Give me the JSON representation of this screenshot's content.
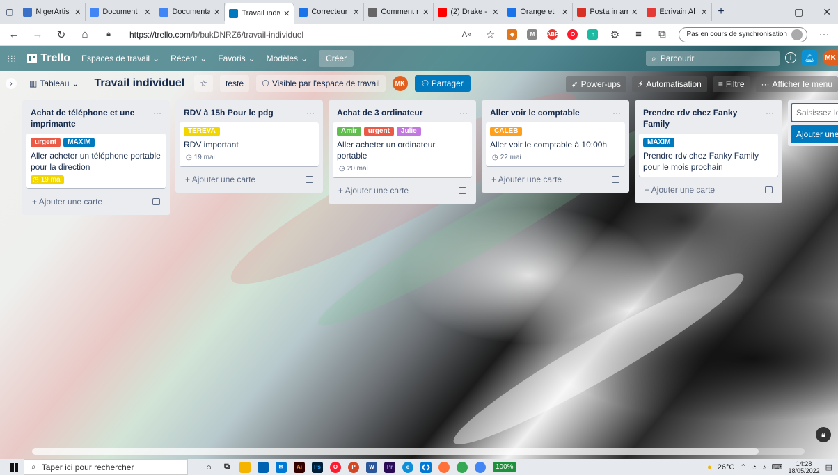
{
  "browser": {
    "tabs": [
      {
        "title": "NigerArtis",
        "color": "#3a70c5"
      },
      {
        "title": "Document",
        "color": "#4285f4"
      },
      {
        "title": "Documenta",
        "color": "#4285f4"
      },
      {
        "title": "Travail indiv",
        "color": "#0079bf",
        "active": true
      },
      {
        "title": "Correcteur",
        "color": "#1a73e8"
      },
      {
        "title": "Comment r",
        "color": "#666666"
      },
      {
        "title": "(2) Drake -",
        "color": "#ff0000"
      },
      {
        "title": "Orange et",
        "color": "#1a73e8"
      },
      {
        "title": "Posta in arr",
        "color": "#d93025"
      },
      {
        "title": "Écrivain Al",
        "color": "#e53935"
      }
    ],
    "new_tab": "+",
    "url_host": "https://trello.com",
    "url_path": "/b/bukDNRZ6/travail-individuel",
    "sync_label": "Pas en cours de synchronisation",
    "more": "···"
  },
  "header": {
    "logo": "Trello",
    "menus": [
      "Espaces de travail",
      "Récent",
      "Favoris",
      "Modèles"
    ],
    "create": "Créer",
    "search_placeholder": "Parcourir",
    "avatar": "MK"
  },
  "board": {
    "view": "Tableau",
    "title": "Travail individuel",
    "workspace": "teste",
    "visibility": "Visible par l'espace de travail",
    "member": "MK",
    "share": "Partager",
    "powerups": "Power-ups",
    "automation": "Automatisation",
    "filter": "Filtre",
    "show_menu": "Afficher le menu"
  },
  "lists": [
    {
      "title": "Achat de téléphone et une imprimante",
      "cards": [
        {
          "labels": [
            {
              "text": "urgent",
              "color": "#eb5a46"
            },
            {
              "text": "MAXIM",
              "color": "#0079bf"
            }
          ],
          "text": "Aller acheter un téléphone portable pour la direction",
          "due": "19 mai",
          "due_yellow": true
        }
      ],
      "add": "Ajouter une carte"
    },
    {
      "title": "RDV à 15h Pour le pdg",
      "cards": [
        {
          "labels": [
            {
              "text": "TEREVA",
              "color": "#f2d600"
            }
          ],
          "text": "RDV important",
          "due": "19 mai",
          "due_yellow": false
        }
      ],
      "add": "Ajouter une carte"
    },
    {
      "title": "Achat de 3 ordinateur",
      "cards": [
        {
          "labels": [
            {
              "text": "Amir",
              "color": "#61bd4f"
            },
            {
              "text": "urgent",
              "color": "#eb5a46"
            },
            {
              "text": "Julie",
              "color": "#c377e0"
            }
          ],
          "text": "Aller acheter un ordinateur portable",
          "due": "20 mai",
          "due_yellow": false
        }
      ],
      "add": "Ajouter une carte"
    },
    {
      "title": "Aller voir le comptable",
      "cards": [
        {
          "labels": [
            {
              "text": "CALEB",
              "color": "#ff9f1a"
            }
          ],
          "text": "Aller voir le comptable à 10:00h",
          "due": "22 mai",
          "due_yellow": false
        }
      ],
      "add": "Ajouter une carte"
    },
    {
      "title": "Prendre rdv chez Fanky Family",
      "cards": [
        {
          "labels": [
            {
              "text": "MAXIM",
              "color": "#0079bf"
            }
          ],
          "text": "Prendre rdv chez Fanky Family pour le mois prochain",
          "due": "",
          "due_yellow": false
        }
      ],
      "add": "Ajouter une carte"
    }
  ],
  "new_list": {
    "placeholder": "Saisissez le ti",
    "button": "Ajouter une l"
  },
  "taskbar": {
    "search_placeholder": "Taper ici pour rechercher",
    "battery": "100%",
    "weather": "26°C",
    "time": "14:28",
    "date": "18/05/2022"
  }
}
